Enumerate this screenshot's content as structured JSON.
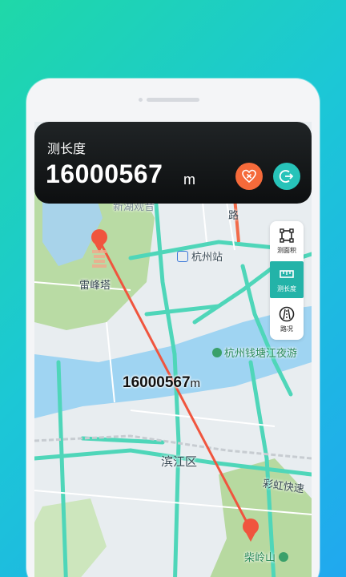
{
  "panel": {
    "title": "测长度",
    "distance_value": "16000567",
    "distance_unit": "m"
  },
  "map_overlay": {
    "distance_value": "16000567",
    "distance_unit": "m"
  },
  "tools": [
    {
      "label": "测面积",
      "icon": "area-measure-icon",
      "active": false
    },
    {
      "label": "测长度",
      "icon": "ruler-icon",
      "active": true
    },
    {
      "label": "路况",
      "icon": "road-icon",
      "active": false
    }
  ],
  "map_labels": {
    "top_partial": "新湖观音",
    "road_partial": "路",
    "leifeng_pagoda": "雷峰塔",
    "hangzhou_station": "杭州站",
    "qiantang_park": "杭州钱塘江夜游",
    "binjiang": "滨江区",
    "caihong_expressway": "彩虹快速",
    "chailing_mountain": "柴岭山"
  },
  "colors": {
    "accent_teal": "#27c3b9",
    "clear_orange": "#f56a3a",
    "measure_line": "#f0553e",
    "river": "#9fd4f2",
    "park_green": "#b7d9a0"
  }
}
